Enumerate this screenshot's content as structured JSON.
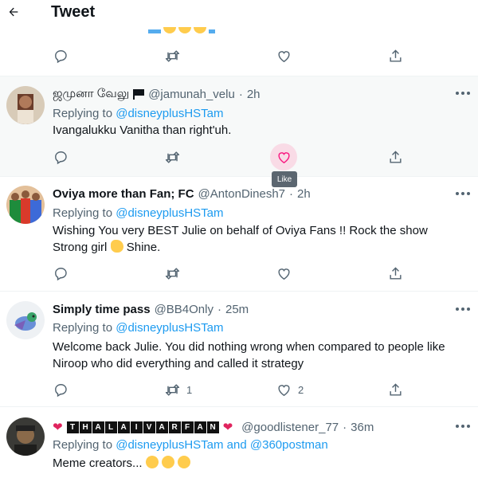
{
  "header": {
    "title": "Tweet",
    "emoji_colors": [
      "#55acee",
      "#ffcc4d",
      "#ffcc4d",
      "#ffcc4d",
      "#55acee"
    ]
  },
  "icons": {
    "reply": "reply-icon",
    "retweet": "retweet-icon",
    "like": "heart-icon",
    "share": "share-icon",
    "more": "more-icon",
    "back": "back-arrow-icon"
  },
  "colors": {
    "link": "#1d9bf0",
    "muted": "#536471",
    "like_hover_bg": "#f9dbe6",
    "like_hover_icon": "#f91880"
  },
  "tooltip": {
    "text": "Like"
  },
  "tweets": [
    {
      "name": "ஜமுனா வேலு",
      "name_has_flag": true,
      "handle": "@jamunah_velu",
      "dot": "·",
      "time": "2h",
      "reply_prefix": "Replying to",
      "reply_mentions": [
        "@disneyplusHSTam"
      ],
      "reply_joiner": "",
      "text": "Ivangalukku Vanitha than right'uh.",
      "reply_count": "",
      "retweet_count": "",
      "like_count": "",
      "like_hover": true
    },
    {
      "name": "Oviya more than Fan; FC",
      "handle": "@AntonDinesh7",
      "dot": "·",
      "time": "2h",
      "reply_prefix": "Replying to",
      "reply_mentions": [
        "@disneyplusHSTam"
      ],
      "reply_joiner": "",
      "text_line1": "Wishing You very BEST Julie on behalf of Oviya Fans !! Rock the show",
      "text_line2_a": "Strong girl",
      "text_line2_emoji": "clapping-hands-emoji",
      "text_line2_b": "Shine.",
      "reply_count": "",
      "retweet_count": "",
      "like_count": ""
    },
    {
      "name": "Simply time pass",
      "handle": "@BB4Only",
      "dot": "·",
      "time": "25m",
      "reply_prefix": "Replying to",
      "reply_mentions": [
        "@disneyplusHSTam"
      ],
      "reply_joiner": "",
      "text": "Welcome back Julie. You did nothing wrong when compared to people like Niroop who did everything and called it strategy",
      "reply_count": "",
      "retweet_count": "1",
      "like_count": "2"
    },
    {
      "name_letters": [
        "T",
        "H",
        "A",
        "L",
        "A",
        "I",
        "V",
        "A",
        "R",
        "F",
        "A",
        "N"
      ],
      "name_heart": "❤",
      "handle": "@goodlistener_77",
      "dot": "·",
      "time": "36m",
      "reply_prefix": "Replying to",
      "reply_mentions": [
        "@disneyplusHSTam",
        "@360postman"
      ],
      "reply_joiner": "and",
      "text": "Meme creators...",
      "text_emojis": [
        "rolling-laughing-emoji",
        "tears-of-joy-emoji",
        "tears-of-joy-emoji"
      ]
    }
  ]
}
